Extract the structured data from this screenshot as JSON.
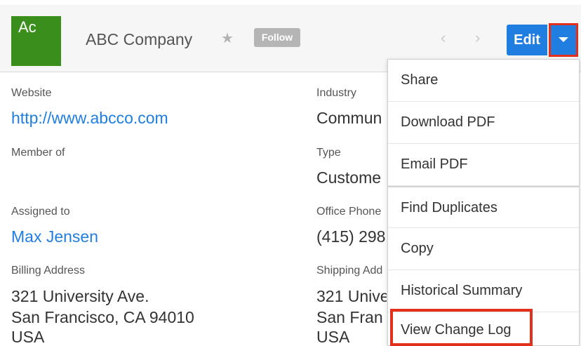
{
  "record": {
    "avatar_text": "Ac",
    "name": "ABC Company",
    "follow_label": "Follow",
    "edit_label": "Edit",
    "star_icon": "star-icon",
    "prev_icon": "chevron-left-icon",
    "next_icon": "chevron-right-icon",
    "caret_icon": "caret-down-icon"
  },
  "left_fields": {
    "website_label": "Website",
    "website_value": "http://www.abcco.com",
    "member_of_label": "Member of",
    "member_of_value": "",
    "assigned_to_label": "Assigned to",
    "assigned_to_value": "Max Jensen",
    "billing_address_label": "Billing Address",
    "billing_address_line1": "321 University Ave.",
    "billing_address_line2": "San Francisco, CA 94010",
    "billing_address_line3": "USA"
  },
  "right_fields": {
    "industry_label": "Industry",
    "industry_value": "Commun",
    "type_label": "Type",
    "type_value": "Custome",
    "office_phone_label": "Office Phone",
    "office_phone_value": "(415) 298",
    "shipping_address_label": "Shipping Add",
    "shipping_address_line1": "321 Unive",
    "shipping_address_line2": "San Fran",
    "shipping_address_line3": "USA"
  },
  "menu": {
    "items": [
      {
        "label": "Share"
      },
      {
        "label": "Download PDF"
      },
      {
        "label": "Email PDF"
      },
      {
        "label": "Find Duplicates"
      },
      {
        "label": "Copy"
      },
      {
        "label": "Historical Summary"
      },
      {
        "label": "View Change Log"
      }
    ]
  },
  "colors": {
    "avatar_bg": "#3a8f1c",
    "accent": "#1f7ee0",
    "highlight": "#e3301b"
  }
}
